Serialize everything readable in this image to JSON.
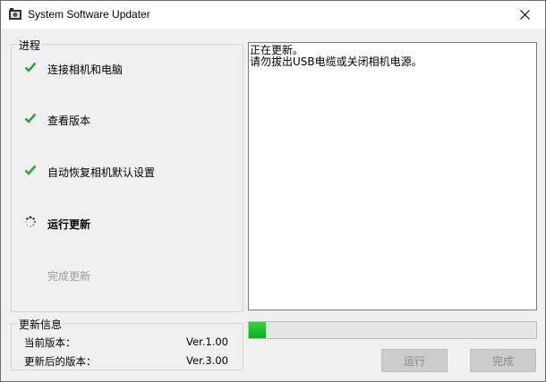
{
  "window": {
    "title": "System Software Updater"
  },
  "progress": {
    "title": "进程",
    "steps": [
      {
        "label": "连接相机和电脑",
        "state": "done"
      },
      {
        "label": "查看版本",
        "state": "done"
      },
      {
        "label": "自动恢复相机默认设置",
        "state": "done"
      },
      {
        "label": "运行更新",
        "state": "active"
      },
      {
        "label": "完成更新",
        "state": "pending"
      }
    ]
  },
  "log": {
    "lines": [
      "正在更新。",
      "请勿拔出USB电缆或关闭相机电源。"
    ]
  },
  "progress_bar": {
    "percent": 6
  },
  "info": {
    "title": "更新信息",
    "current_label": "当前版本：",
    "current_value": "Ver.1.00",
    "after_label": "更新后的版本：",
    "after_value": "Ver.3.00"
  },
  "buttons": {
    "run": "运行",
    "finish": "完成"
  },
  "colors": {
    "check": "#2fa33b",
    "progress_fill": "#06b025",
    "disabled_text": "#9b9b9b"
  },
  "icons": {
    "app": "camera-app-icon",
    "close": "close-icon",
    "done": "check-icon",
    "active": "spinner-icon"
  }
}
